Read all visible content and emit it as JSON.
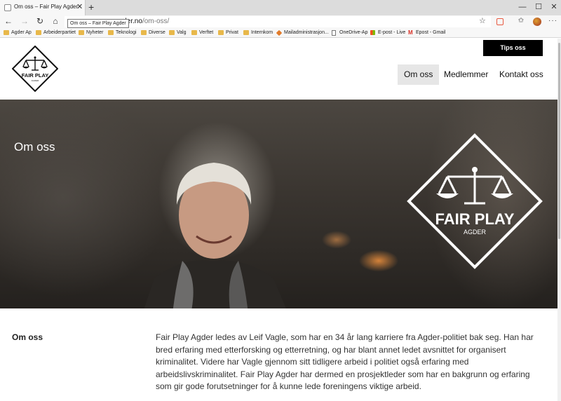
{
  "browser": {
    "tab_title": "Om oss – Fair Play Agder",
    "tooltip": "Om oss – Fair Play Agder",
    "address_host": "agder.no",
    "address_path": "/om-oss/",
    "bookmarks": [
      {
        "label": "Agder Ap",
        "icon": "folder-icon"
      },
      {
        "label": "Arbeiderpartiet",
        "icon": "folder-icon"
      },
      {
        "label": "Nyheter",
        "icon": "folder-icon"
      },
      {
        "label": "Teknologi",
        "icon": "folder-icon"
      },
      {
        "label": "Diverse",
        "icon": "folder-icon"
      },
      {
        "label": "Valg",
        "icon": "folder-icon"
      },
      {
        "label": "Verftet",
        "icon": "folder-icon"
      },
      {
        "label": "Privat",
        "icon": "folder-icon"
      },
      {
        "label": "Internkom",
        "icon": "folder-icon"
      },
      {
        "label": "Mailadministrasjon...",
        "icon": "office-icon"
      },
      {
        "label": "OneDrive-Ap",
        "icon": "page-icon"
      },
      {
        "label": "E-post - Live",
        "icon": "windows-icon"
      },
      {
        "label": "Epost - Gmail",
        "icon": "gmail-icon"
      }
    ]
  },
  "site": {
    "logo_text": "FAIR PLAY",
    "logo_sub": "AGDER",
    "tips_button": "Tips oss",
    "nav": [
      {
        "label": "Om oss",
        "active": true
      },
      {
        "label": "Medlemmer",
        "active": false
      },
      {
        "label": "Kontakt oss",
        "active": false
      }
    ],
    "hero_title": "Om oss",
    "section_label": "Om oss",
    "body": "Fair Play Agder ledes av Leif Vagle, som har en 34 år lang karriere fra Agder-politiet bak seg. Han har bred erfaring med etterforsking og etterretning, og har blant annet ledet avsnittet for organisert kriminalitet. Videre har Vagle gjennom sitt tidligere arbeid i politiet også erfaring med arbeidslivskriminalitet. Fair Play Agder har dermed en prosjektleder som har en bakgrunn og erfaring som gir gode forutsetninger for å kunne lede foreningens viktige arbeid."
  }
}
